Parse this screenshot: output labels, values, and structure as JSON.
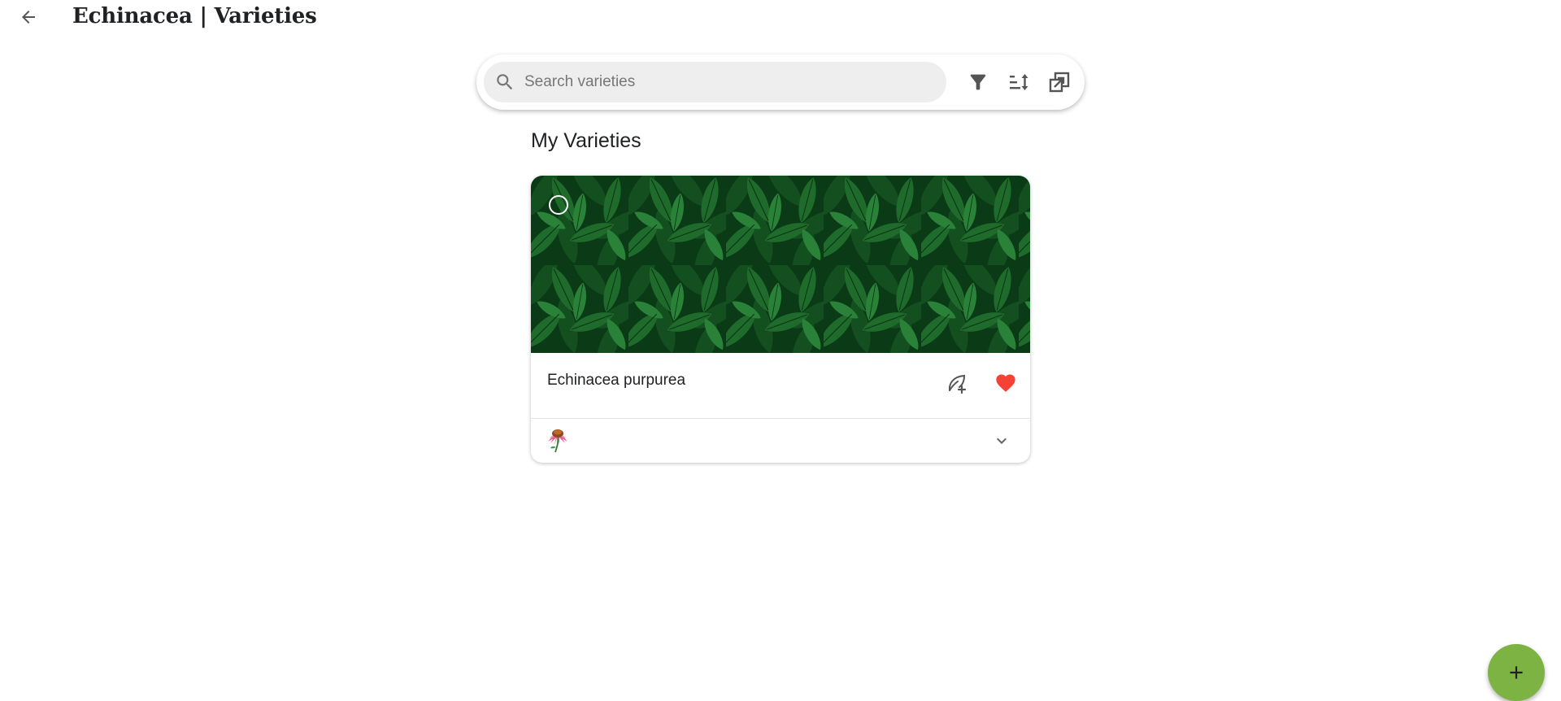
{
  "header": {
    "title": "Echinacea | Varieties",
    "back_icon": "arrow-left-icon"
  },
  "search": {
    "placeholder": "Search varieties",
    "value": "",
    "icon": "search-icon"
  },
  "toolbar": {
    "filter_icon": "filter-icon",
    "sort_icon": "sort-icon",
    "view_icon": "open-in-new-icon"
  },
  "section": {
    "title": "My Varieties"
  },
  "varieties": [
    {
      "name": "Echinacea purpurea",
      "image": "green-leaves-background",
      "selected": false,
      "favorite": true,
      "favorite_color": "#f44336",
      "add_plant_icon": "leaf-plus-icon",
      "flower_icon": "coneflower-icon",
      "expand_icon": "chevron-down-icon"
    }
  ],
  "fab": {
    "icon": "plus-icon",
    "color": "#7cb342"
  },
  "colors": {
    "accent": "#7cb342",
    "favorite": "#f44336",
    "leaf_dark": "#0c3d17",
    "leaf": "#1f6e2c"
  }
}
